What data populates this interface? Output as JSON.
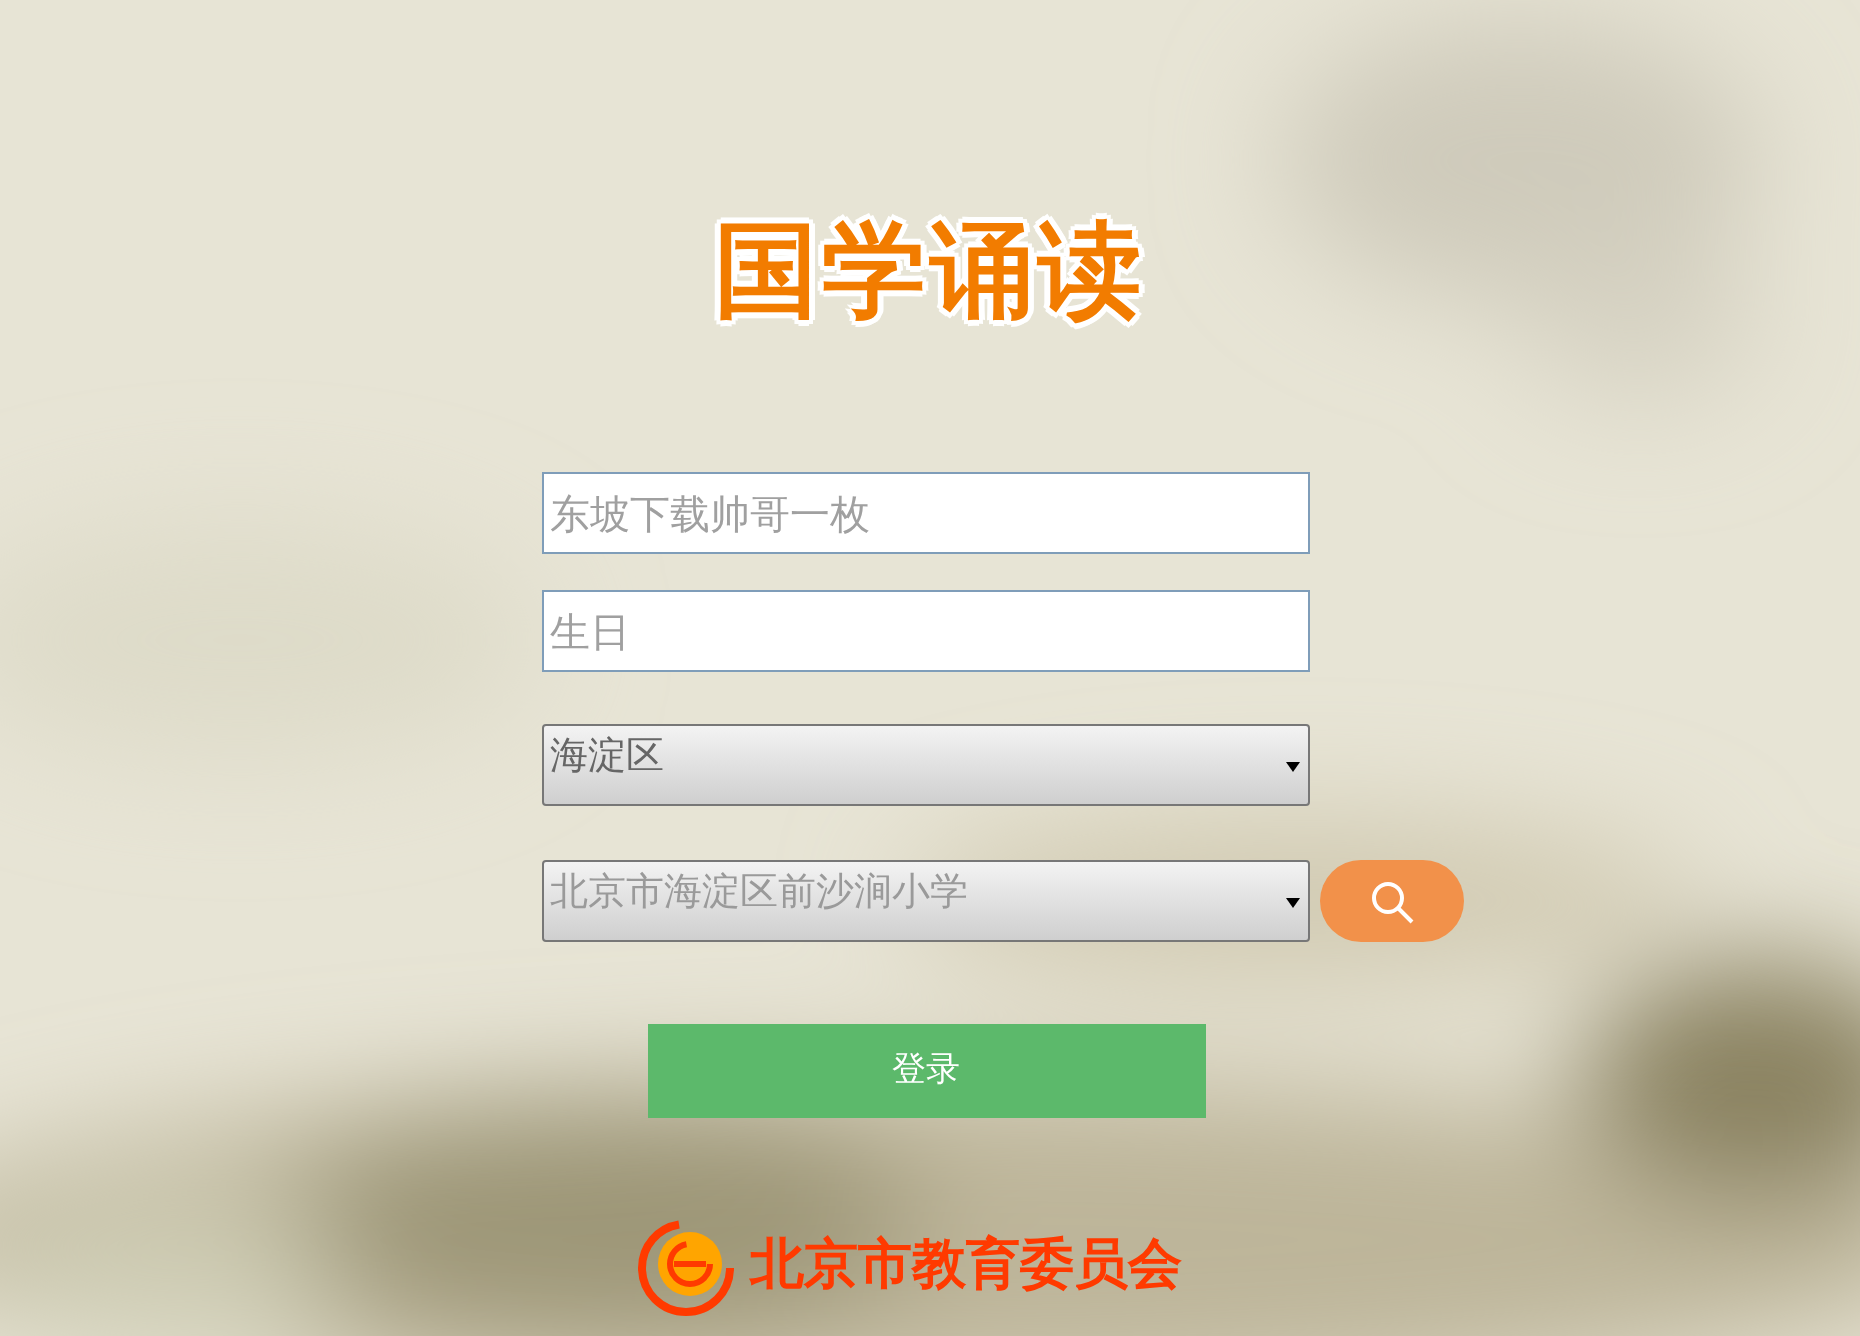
{
  "title": "国学诵读",
  "fields": [
    {
      "kind": "text",
      "placeholder": "东坡下载帅哥一枚"
    },
    {
      "kind": "text",
      "placeholder": "生日"
    },
    {
      "kind": "select",
      "value": "海淀区"
    },
    {
      "kind": "select",
      "value": "北京市海淀区前沙涧小学",
      "search": true
    }
  ],
  "login_button": "登录",
  "footer": "北京市教育委员会"
}
